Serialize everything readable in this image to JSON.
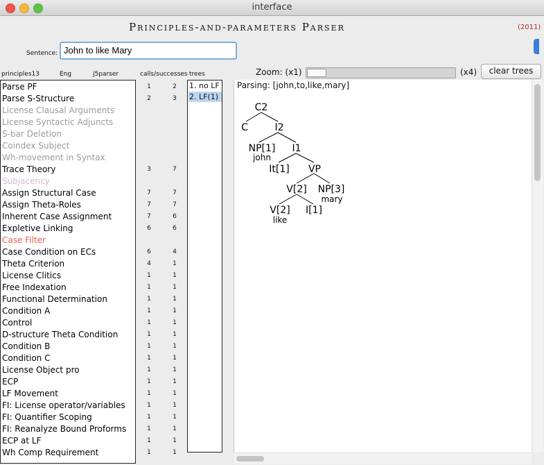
{
  "window": {
    "title": "interface"
  },
  "app": {
    "title": "Principles-and-parameters Parser",
    "year": "(2011)"
  },
  "sentence": {
    "label": "Sentence:",
    "value": "John to like Mary"
  },
  "columns": {
    "principles": "principles13",
    "lang": "Eng",
    "parser": "j5parser",
    "calls": "calls/successes",
    "trees": "trees"
  },
  "zoom": {
    "label": "Zoom: (x1)",
    "max_label": "(x4)",
    "level": 1
  },
  "clear_button": "clear trees",
  "principles": [
    {
      "name": "Parse PF",
      "calls": "1",
      "successes": "2",
      "color": "#000000"
    },
    {
      "name": "Parse S-Structure",
      "calls": "2",
      "successes": "3",
      "color": "#000000"
    },
    {
      "name": "License Clausal Arguments",
      "calls": "",
      "successes": "",
      "color": "#9a9a9a"
    },
    {
      "name": "License Syntactic Adjuncts",
      "calls": "",
      "successes": "",
      "color": "#9a9a9a"
    },
    {
      "name": "S-bar Deletion",
      "calls": "",
      "successes": "",
      "color": "#9a9a9a"
    },
    {
      "name": "Coindex Subject",
      "calls": "",
      "successes": "",
      "color": "#9a9a9a"
    },
    {
      "name": "Wh-movement in Syntax",
      "calls": "",
      "successes": "",
      "color": "#9a9a9a"
    },
    {
      "name": "Trace Theory",
      "calls": "3",
      "successes": "7",
      "color": "#000000"
    },
    {
      "name": "Subjacency",
      "calls": "",
      "successes": "",
      "color": "#d9b8d4"
    },
    {
      "name": "Assign Structural Case",
      "calls": "7",
      "successes": "7",
      "color": "#000000"
    },
    {
      "name": "Assign Theta-Roles",
      "calls": "7",
      "successes": "7",
      "color": "#000000"
    },
    {
      "name": "Inherent Case Assignment",
      "calls": "7",
      "successes": "6",
      "color": "#000000"
    },
    {
      "name": "Expletive Linking",
      "calls": "6",
      "successes": "6",
      "color": "#000000"
    },
    {
      "name": "Case Filter",
      "calls": "",
      "successes": "",
      "color": "#e8604a"
    },
    {
      "name": "Case Condition on ECs",
      "calls": "6",
      "successes": "4",
      "color": "#000000"
    },
    {
      "name": "Theta Criterion",
      "calls": "4",
      "successes": "1",
      "color": "#000000"
    },
    {
      "name": "License Clitics",
      "calls": "1",
      "successes": "1",
      "color": "#000000"
    },
    {
      "name": "Free Indexation",
      "calls": "1",
      "successes": "1",
      "color": "#000000"
    },
    {
      "name": "Functional Determination",
      "calls": "1",
      "successes": "1",
      "color": "#000000"
    },
    {
      "name": "Condition A",
      "calls": "1",
      "successes": "1",
      "color": "#000000"
    },
    {
      "name": "Control",
      "calls": "1",
      "successes": "1",
      "color": "#000000"
    },
    {
      "name": "D-structure Theta Condition",
      "calls": "1",
      "successes": "1",
      "color": "#000000"
    },
    {
      "name": "Condition B",
      "calls": "1",
      "successes": "1",
      "color": "#000000"
    },
    {
      "name": "Condition C",
      "calls": "1",
      "successes": "1",
      "color": "#000000"
    },
    {
      "name": "License Object pro",
      "calls": "1",
      "successes": "1",
      "color": "#000000"
    },
    {
      "name": "ECP",
      "calls": "1",
      "successes": "1",
      "color": "#000000"
    },
    {
      "name": "LF Movement",
      "calls": "1",
      "successes": "1",
      "color": "#000000"
    },
    {
      "name": "FI: License operator/variables",
      "calls": "1",
      "successes": "1",
      "color": "#000000"
    },
    {
      "name": "FI: Quantifier Scoping",
      "calls": "1",
      "successes": "1",
      "color": "#000000"
    },
    {
      "name": "FI: Reanalyze Bound Proforms",
      "calls": "1",
      "successes": "1",
      "color": "#000000"
    },
    {
      "name": "ECP at LF",
      "calls": "1",
      "successes": "1",
      "color": "#000000"
    },
    {
      "name": "Wh Comp Requirement",
      "calls": "1",
      "successes": "1",
      "color": "#000000"
    }
  ],
  "trees_list": [
    {
      "label": "1. no LF",
      "selected": false
    },
    {
      "label": "2. LF(1)",
      "selected": true
    }
  ],
  "parsing_text": "Parsing: [john,to,like,mary]",
  "parse_tree": {
    "labels": {
      "c2": "C2",
      "c": "C",
      "i2": "I2",
      "np1": "NP[1]",
      "john": "john",
      "i1": "I1",
      "it1": "It[1]",
      "vp": "VP",
      "v2": "V[2]",
      "np3": "NP[3]",
      "mary": "mary",
      "v2b": "V[2]",
      "like": "like",
      "i1b": "I[1]"
    }
  },
  "icons": {
    "traffic_lights": [
      "close-icon",
      "minimize-icon",
      "zoom-icon"
    ]
  }
}
